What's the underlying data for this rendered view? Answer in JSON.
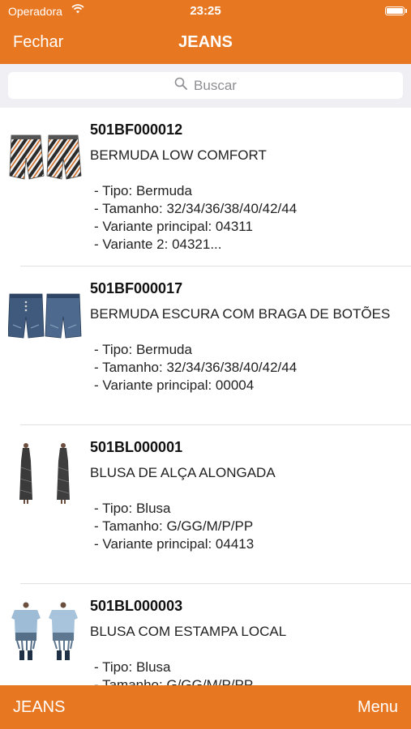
{
  "status": {
    "carrier": "Operadora",
    "time": "23:25"
  },
  "nav": {
    "close_label": "Fechar",
    "title": "JEANS"
  },
  "search": {
    "placeholder": "Buscar"
  },
  "items": [
    {
      "code": "501BF000012",
      "name": "BERMUDA LOW COMFORT",
      "details": [
        "- Tipo: Bermuda",
        "- Tamanho: 32/34/36/38/40/42/44",
        "- Variante principal: 04311",
        "- Variante 2: 04321..."
      ]
    },
    {
      "code": "501BF000017",
      "name": "BERMUDA ESCURA COM BRAGA DE BOTÕES",
      "details": [
        "- Tipo: Bermuda",
        "- Tamanho: 32/34/36/38/40/42/44",
        "- Variante principal: 00004"
      ]
    },
    {
      "code": "501BL000001",
      "name": "BLUSA DE ALÇA ALONGADA",
      "details": [
        "- Tipo: Blusa",
        "- Tamanho: G/GG/M/P/PP",
        "- Variante principal: 04413"
      ]
    },
    {
      "code": "501BL000003",
      "name": "BLUSA COM ESTAMPA LOCAL",
      "details": [
        "- Tipo: Blusa",
        "- Tamanho: G/GG/M/P/PP"
      ]
    }
  ],
  "tabbar": {
    "left_label": "JEANS",
    "right_label": "Menu"
  },
  "colors": {
    "accent": "#e87722",
    "search_bg": "#efeff4"
  }
}
